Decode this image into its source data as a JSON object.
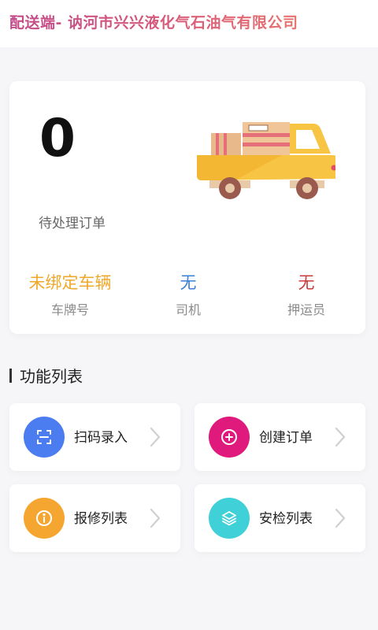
{
  "header": {
    "title": "配送端- 讷河市兴兴液化气石油气有限公司"
  },
  "summary": {
    "pending_count": "0",
    "pending_label": "待处理订单",
    "vehicle": {
      "value": "未绑定车辆",
      "label": "车牌号",
      "color": "#f0a72a"
    },
    "driver": {
      "value": "无",
      "label": "司机",
      "color": "#3b7fd8"
    },
    "escort": {
      "value": "无",
      "label": "押运员",
      "color": "#c83a3a"
    }
  },
  "functions": {
    "title": "功能列表",
    "items": [
      {
        "label": "扫码录入",
        "icon": "scan-icon",
        "color": "#4b7cf0"
      },
      {
        "label": "创建订单",
        "icon": "plus-circle-icon",
        "color": "#e0197d"
      },
      {
        "label": "报修列表",
        "icon": "info-icon",
        "color": "#f5a630"
      },
      {
        "label": "安检列表",
        "icon": "layers-icon",
        "color": "#3fd0d8"
      }
    ]
  }
}
